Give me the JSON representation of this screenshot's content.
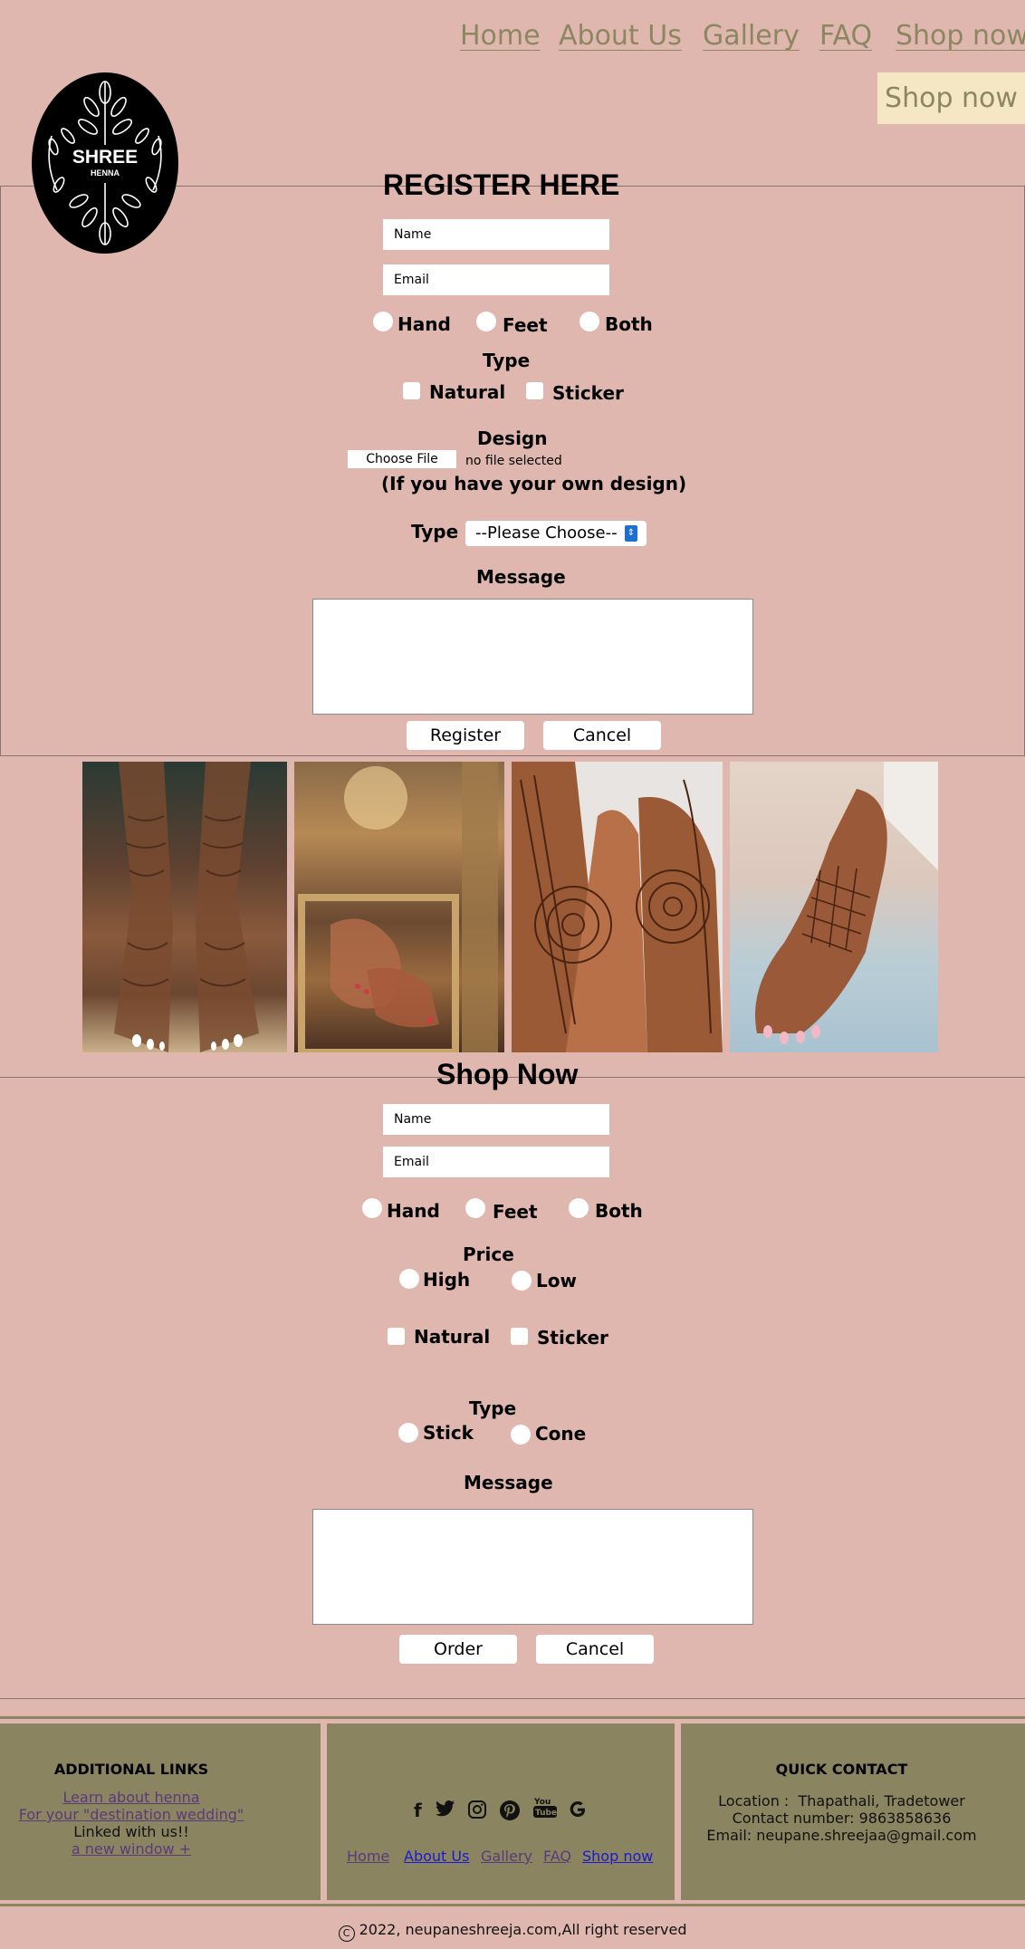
{
  "nav": {
    "home": "Home",
    "about": "About Us",
    "gallery": "Gallery",
    "faq": "FAQ",
    "shop": "Shop now",
    "shop_button": "Shop now"
  },
  "logo": {
    "name": "SHREE",
    "sub": "HENNA"
  },
  "register": {
    "title": "REGISTER HERE",
    "name_placeholder": "Name",
    "email_placeholder": "Email",
    "part_options": [
      "Hand",
      "Feet",
      "Both"
    ],
    "type_label": "Type",
    "type_options": [
      "Natural",
      "Sticker"
    ],
    "design_label": "Design",
    "choose_file": "Choose File",
    "no_file": "no file selected",
    "design_note": "(If you have your own design)",
    "select_label": "Type",
    "select_value": "--Please Choose--",
    "message_label": "Message",
    "register_button": "Register",
    "cancel_button": "Cancel"
  },
  "gallery": {
    "images": [
      "henna-feet-photo",
      "henna-feet-mirror-photo",
      "henna-hands-mandala-photo",
      "henna-hands-pink-nails-photo"
    ]
  },
  "shop": {
    "title": "Shop Now",
    "name_placeholder": "Name",
    "email_placeholder": "Email",
    "part_options": [
      "Hand",
      "Feet",
      "Both"
    ],
    "price_label": "Price",
    "price_options": [
      "High",
      "Low"
    ],
    "kind_options": [
      "Natural",
      "Sticker"
    ],
    "type_label": "Type",
    "type_options": [
      "Stick",
      "Cone"
    ],
    "message_label": "Message",
    "order_button": "Order",
    "cancel_button": "Cancel"
  },
  "footer": {
    "links_title": "ADDITIONAL LINKS",
    "link1": "Learn about henna",
    "link2": "For your \"destination wedding\"",
    "linked_text": "Linked with us!!",
    "link3": "a new window +",
    "social_icons": [
      "facebook-icon",
      "twitter-icon",
      "instagram-icon",
      "pinterest-icon",
      "youtube-icon",
      "google-icon"
    ],
    "nav": [
      "Home",
      "About Us",
      "Gallery",
      "FAQ",
      "Shop now"
    ],
    "contact_title": "QUICK CONTACT",
    "location": "Location :  Thapathali, Tradetower",
    "phone": "Contact number: 9863858636",
    "email": "Email: neupane.shreejaa@gmail.com",
    "copyright": "2022, neupaneshreeja.com,All right reserved"
  },
  "colors": {
    "background": "#dfb7ae",
    "nav_text": "#8b8760",
    "shop_button_bg": "#f5e7c4",
    "footer_bg": "#8b8460"
  }
}
